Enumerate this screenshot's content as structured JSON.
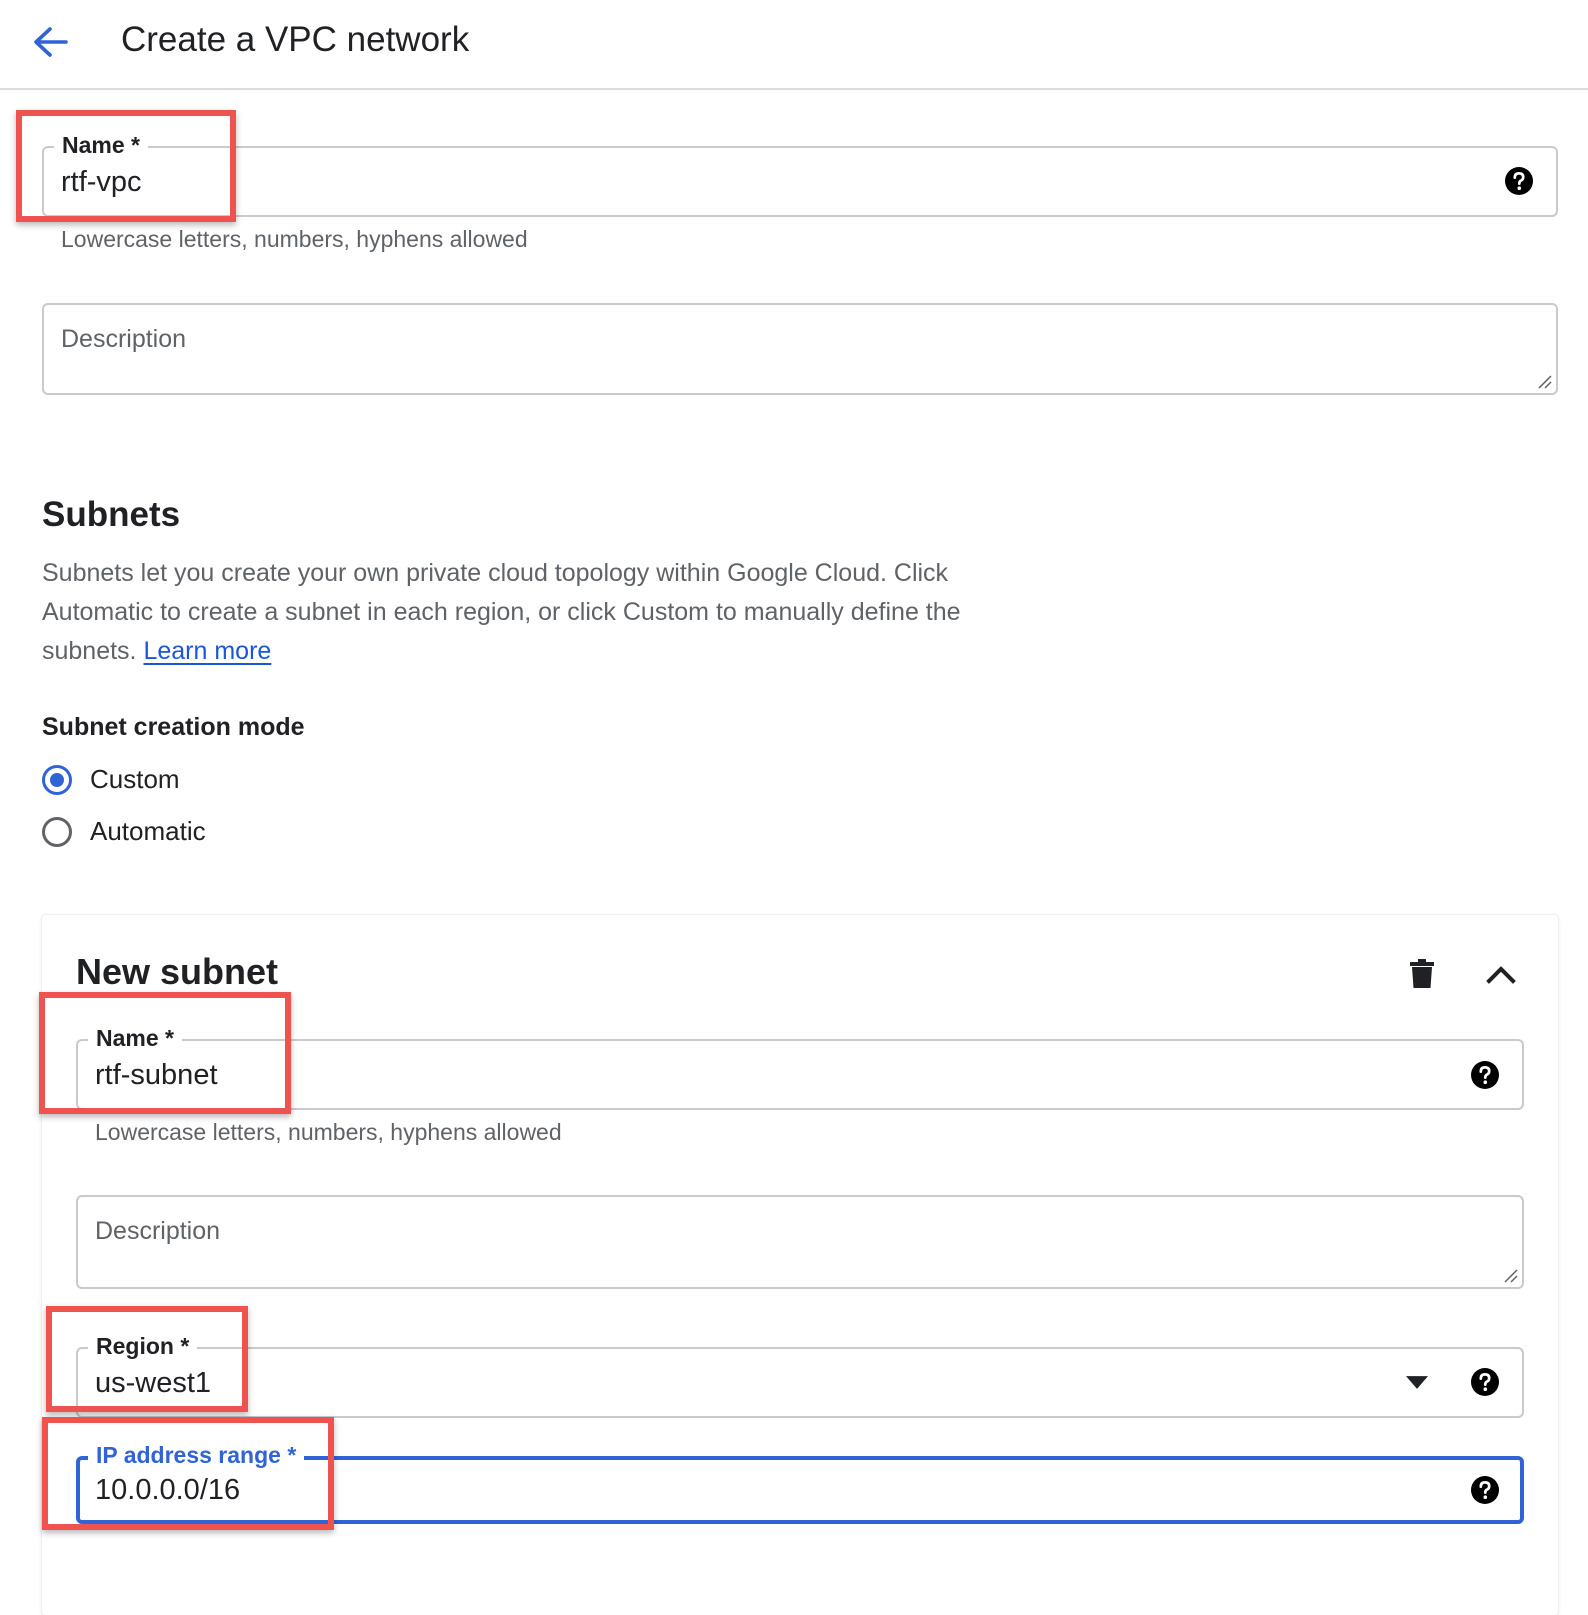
{
  "header": {
    "title": "Create a VPC network",
    "back_icon": "arrow-back-icon"
  },
  "network": {
    "name_label": "Name *",
    "name_value": "rtf-vpc",
    "name_hint": "Lowercase letters, numbers, hyphens allowed",
    "description_placeholder": "Description"
  },
  "subnets": {
    "title": "Subnets",
    "description": "Subnets let you create your own private cloud topology within Google Cloud. Click Automatic to create a subnet in each region, or click Custom to manually define the subnets.",
    "learn_more": "Learn more",
    "mode_label": "Subnet creation mode",
    "modes": [
      {
        "label": "Custom",
        "selected": true
      },
      {
        "label": "Automatic",
        "selected": false
      }
    ]
  },
  "new_subnet": {
    "title": "New subnet",
    "name_label": "Name *",
    "name_value": "rtf-subnet",
    "name_hint": "Lowercase letters, numbers, hyphens allowed",
    "description_placeholder": "Description",
    "region_label": "Region *",
    "region_value": "us-west1",
    "ip_label": "IP address range *",
    "ip_value": "10.0.0.0/16"
  },
  "colors": {
    "accent": "#2f63d6",
    "link": "#1a57d6",
    "annotation": "#ef5350"
  }
}
